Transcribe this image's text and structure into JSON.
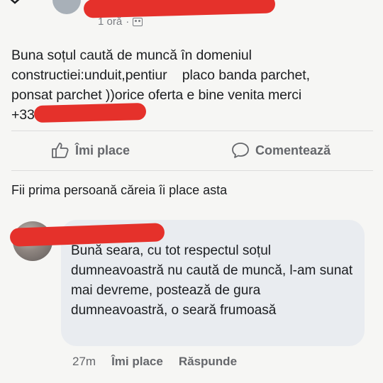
{
  "post": {
    "time": "1 oră",
    "separator": "·",
    "audience_icon": "friends-icon",
    "text": "Buna soțul caută de muncă în domeniul\nconstructiei:unduit,pentiur    placo banda parchet,\nponsat parchet ))orice oferta e bine venita merci\n+33"
  },
  "actions": {
    "like_label": "Îmi place",
    "comment_label": "Comentează"
  },
  "reactions": {
    "first_like_text": "Fii prima persoană căreia îi place asta"
  },
  "comment": {
    "text": "Bună seara, cu tot respectul soțul dumneavoastră nu caută de muncă, l-am sunat mai devreme, postează de gura dumneavoastră, o seară frumoasă",
    "time": "27m",
    "like_label": "Îmi place",
    "reply_label": "Răspunde"
  },
  "colors": {
    "redaction": "#e5312b",
    "bubble": "#e9ecf0",
    "muted_text": "#65676b"
  }
}
